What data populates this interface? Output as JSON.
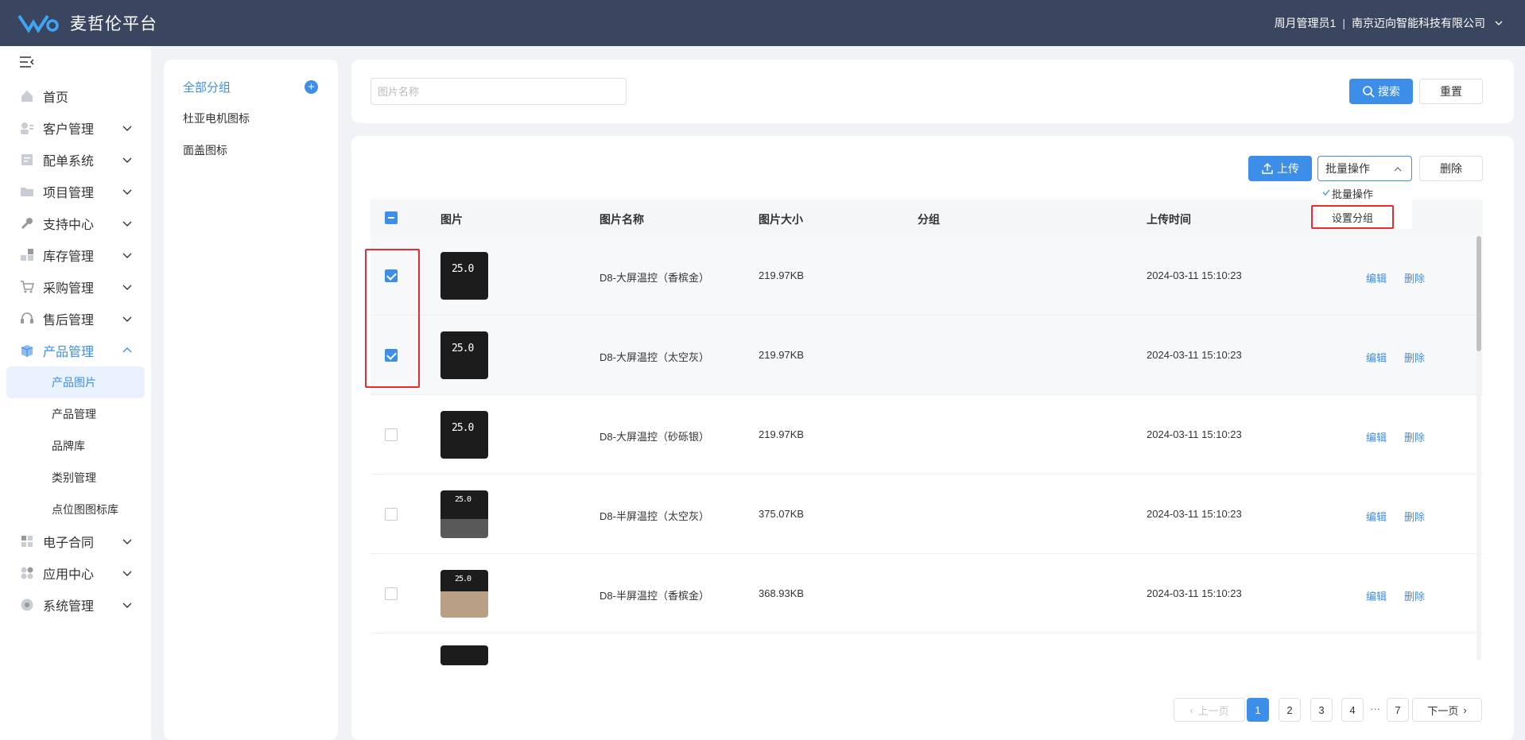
{
  "header": {
    "app_title": "麦哲伦平台",
    "user_name": "周月管理员1",
    "separator": "|",
    "company": "南京迈向智能科技有限公司"
  },
  "sidebar": {
    "items": [
      {
        "label": "首页",
        "icon": "home-icon"
      },
      {
        "label": "客户管理",
        "icon": "customer-icon"
      },
      {
        "label": "配单系统",
        "icon": "order-icon"
      },
      {
        "label": "项目管理",
        "icon": "folder-icon"
      },
      {
        "label": "支持中心",
        "icon": "wrench-icon"
      },
      {
        "label": "库存管理",
        "icon": "inventory-icon"
      },
      {
        "label": "采购管理",
        "icon": "cart-icon"
      },
      {
        "label": "售后管理",
        "icon": "headset-icon"
      },
      {
        "label": "产品管理",
        "icon": "box-icon"
      },
      {
        "label": "电子合同",
        "icon": "contract-icon"
      },
      {
        "label": "应用中心",
        "icon": "apps-icon"
      },
      {
        "label": "系统管理",
        "icon": "settings-icon"
      }
    ],
    "product_sub": [
      "产品图片",
      "产品管理",
      "品牌库",
      "类别管理",
      "点位图图标库"
    ]
  },
  "groups": {
    "all": "全部分组",
    "items": [
      "杜亚电机图标",
      "面盖图标"
    ]
  },
  "search": {
    "placeholder": "图片名称",
    "search_label": "搜索",
    "reset_label": "重置"
  },
  "toolbar": {
    "upload_label": "上传",
    "batch_label": "批量操作",
    "delete_label": "删除",
    "dropdown": [
      "批量操作",
      "设置分组"
    ]
  },
  "table": {
    "headers": [
      "图片",
      "图片名称",
      "图片大小",
      "分组",
      "上传时间"
    ],
    "edit_label": "编辑",
    "delete_label": "删除",
    "rows": [
      {
        "name": "D8-大屏温控（香槟金）",
        "size": "219.97KB",
        "group": "",
        "time": "2024-03-11 15:10:23",
        "checked": true
      },
      {
        "name": "D8-大屏温控（太空灰）",
        "size": "219.97KB",
        "group": "",
        "time": "2024-03-11 15:10:23",
        "checked": true
      },
      {
        "name": "D8-大屏温控（砂砾银）",
        "size": "219.97KB",
        "group": "",
        "time": "2024-03-11 15:10:23",
        "checked": false
      },
      {
        "name": "D8-半屏温控（太空灰）",
        "size": "375.07KB",
        "group": "",
        "time": "2024-03-11 15:10:23",
        "checked": false
      },
      {
        "name": "D8-半屏温控（香槟金）",
        "size": "368.93KB",
        "group": "",
        "time": "2024-03-11 15:10:23",
        "checked": false
      }
    ],
    "thumb_text": "25.0"
  },
  "pagination": {
    "prev": "上一页",
    "next": "下一页",
    "pages": [
      "1",
      "2",
      "3",
      "4",
      "7"
    ],
    "ellipsis": "···",
    "current": "1"
  },
  "colors": {
    "header_bg": "#3a4560",
    "accent": "#3d8ee8",
    "highlight": "#e62e2e"
  }
}
